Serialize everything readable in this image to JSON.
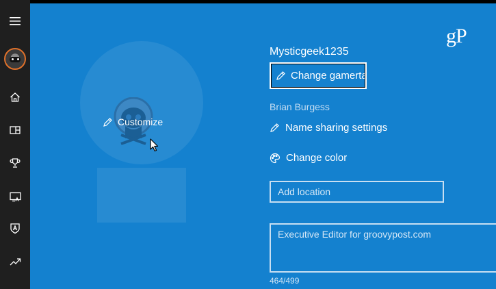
{
  "sidebar": {
    "items": [
      {
        "name": "menu",
        "icon": "hamburger-icon"
      },
      {
        "name": "profile",
        "icon": "avatar-icon"
      },
      {
        "name": "home",
        "icon": "home-icon"
      },
      {
        "name": "activity",
        "icon": "activity-feed-icon"
      },
      {
        "name": "achievements",
        "icon": "trophy-icon"
      },
      {
        "name": "game-dvr",
        "icon": "game-dvr-icon"
      },
      {
        "name": "clubs",
        "icon": "shield-icon"
      },
      {
        "name": "trending",
        "icon": "trending-icon"
      }
    ]
  },
  "profile": {
    "customize_label": "Customize",
    "gamertag": "Mysticgeek1235",
    "change_gamertag_label": "Change gamertag",
    "real_name": "Brian Burgess",
    "name_sharing_label": "Name sharing settings",
    "change_color_label": "Change color",
    "location_placeholder": "Add location",
    "bio": "Executive Editor for groovypost.com",
    "bio_counter": "464/499"
  },
  "watermark": "gP",
  "colors": {
    "panel": "#1481cf",
    "sidebar": "#1f1f1f",
    "text": "#ffffff"
  }
}
